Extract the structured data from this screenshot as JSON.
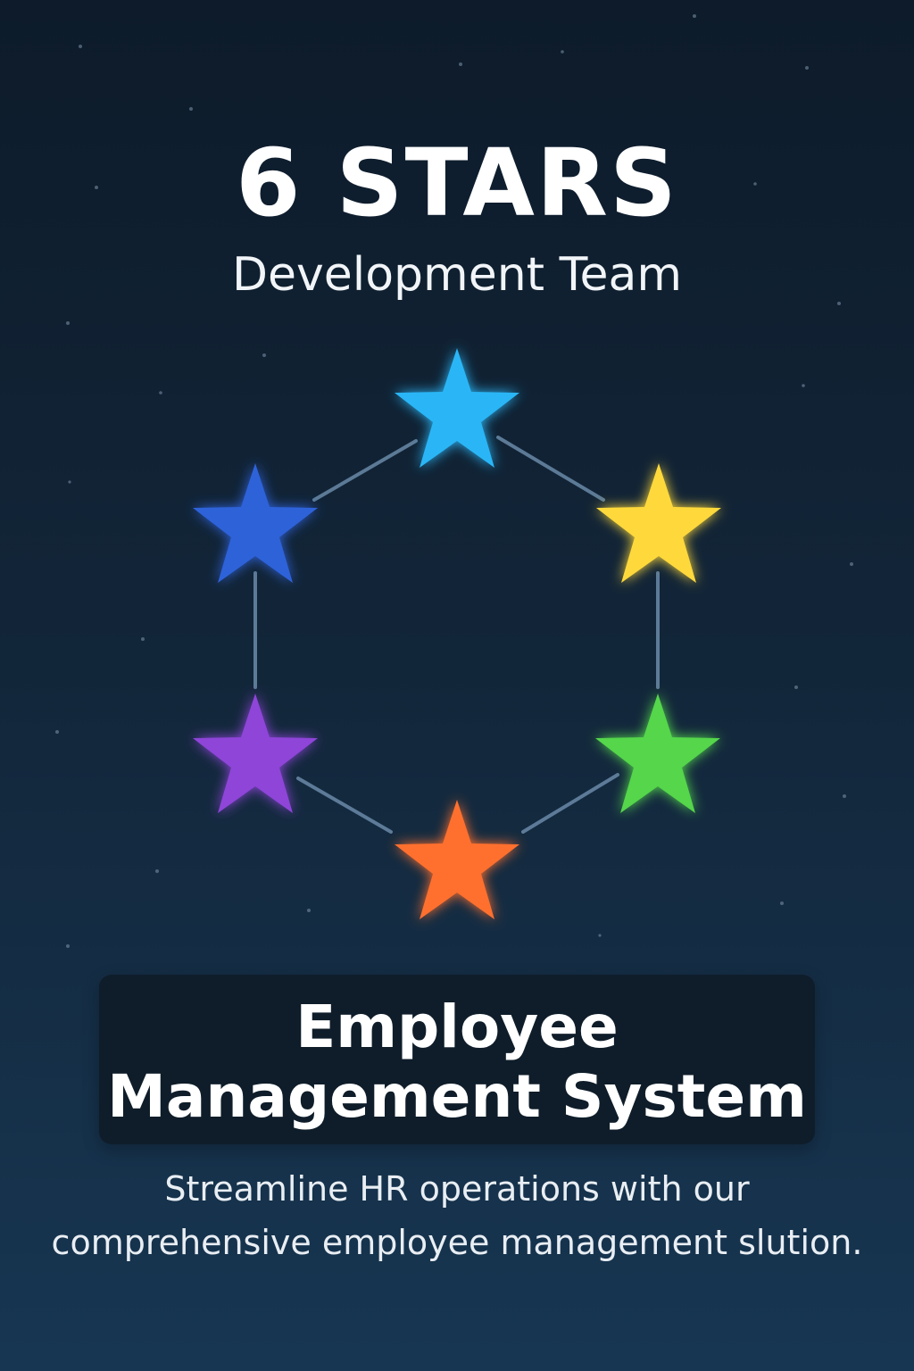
{
  "header": {
    "title": "6 STARS",
    "subtitle": "Development Team"
  },
  "product": {
    "title_line1": "Employee",
    "title_line2": "Management System"
  },
  "tagline": {
    "line1": "Streamline HR operations with our",
    "line2": "comprehensive employee management slution."
  },
  "colors": {
    "background_top": "#0d1b2a",
    "background_bottom": "#173652",
    "connector": "#6a8aa8",
    "card": "#0f1d2a",
    "text": "#ffffff"
  },
  "stars": [
    {
      "name": "star-top",
      "color": "#29b6f6"
    },
    {
      "name": "star-upper-right",
      "color": "#ffd93b"
    },
    {
      "name": "star-lower-right",
      "color": "#54d64c"
    },
    {
      "name": "star-bottom",
      "color": "#ff6f2d"
    },
    {
      "name": "star-lower-left",
      "color": "#8e44d8"
    },
    {
      "name": "star-upper-left",
      "color": "#2e62d9"
    }
  ]
}
